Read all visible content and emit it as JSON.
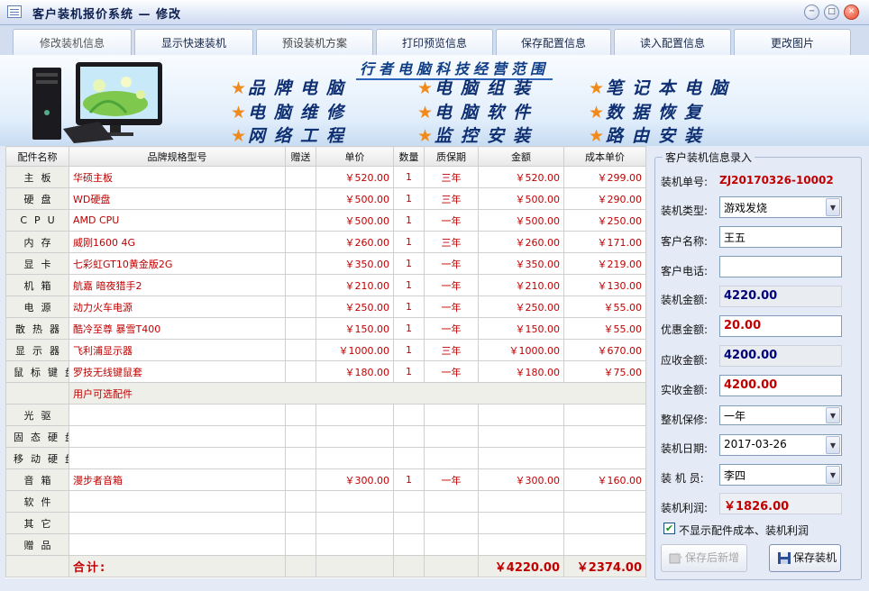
{
  "window": {
    "title": "客户装机报价系统 — 修改"
  },
  "tabs": [
    {
      "label": "修改装机信息"
    },
    {
      "label": "显示快速装机"
    },
    {
      "label": "预设装机方案"
    },
    {
      "label": "打印预览信息"
    },
    {
      "label": "保存配置信息"
    },
    {
      "label": "读入配置信息"
    },
    {
      "label": "更改图片"
    }
  ],
  "banner": {
    "title": "行者电脑科技经营范围",
    "items": [
      {
        "label": "品牌电脑"
      },
      {
        "label": "电脑组装"
      },
      {
        "label": "笔记本电脑"
      },
      {
        "label": "电脑维修"
      },
      {
        "label": "电脑软件"
      },
      {
        "label": "数据恢复"
      },
      {
        "label": "网络工程"
      },
      {
        "label": "监控安装"
      },
      {
        "label": "路由安装"
      }
    ]
  },
  "table": {
    "headers": [
      "配件名称",
      "品牌规格型号",
      "赠送",
      "单价",
      "数量",
      "质保期",
      "金额",
      "成本单价"
    ],
    "rows": [
      {
        "name": "主板",
        "brand": "华硕主板",
        "gift": "",
        "price": "￥520.00",
        "qty": "1",
        "warranty": "三年",
        "amount": "￥520.00",
        "cost": "￥299.00"
      },
      {
        "name": "硬盘",
        "brand": "WD硬盘",
        "gift": "",
        "price": "￥500.00",
        "qty": "1",
        "warranty": "三年",
        "amount": "￥500.00",
        "cost": "￥290.00"
      },
      {
        "name": "CPU",
        "brand": "AMD CPU",
        "gift": "",
        "price": "￥500.00",
        "qty": "1",
        "warranty": "一年",
        "amount": "￥500.00",
        "cost": "￥250.00"
      },
      {
        "name": "内存",
        "brand": "威刚1600 4G",
        "gift": "",
        "price": "￥260.00",
        "qty": "1",
        "warranty": "三年",
        "amount": "￥260.00",
        "cost": "￥171.00"
      },
      {
        "name": "显卡",
        "brand": "七彩虹GT10黄金版2G",
        "gift": "",
        "price": "￥350.00",
        "qty": "1",
        "warranty": "一年",
        "amount": "￥350.00",
        "cost": "￥219.00"
      },
      {
        "name": "机箱",
        "brand": "航嘉 暗夜猎手2",
        "gift": "",
        "price": "￥210.00",
        "qty": "1",
        "warranty": "一年",
        "amount": "￥210.00",
        "cost": "￥130.00"
      },
      {
        "name": "电源",
        "brand": "动力火车电源",
        "gift": "",
        "price": "￥250.00",
        "qty": "1",
        "warranty": "一年",
        "amount": "￥250.00",
        "cost": "￥55.00"
      },
      {
        "name": "散热器",
        "brand": "酷冷至尊 暴雪T400",
        "gift": "",
        "price": "￥150.00",
        "qty": "1",
        "warranty": "一年",
        "amount": "￥150.00",
        "cost": "￥55.00"
      },
      {
        "name": "显示器",
        "brand": "飞利浦显示器",
        "gift": "",
        "price": "￥1000.00",
        "qty": "1",
        "warranty": "三年",
        "amount": "￥1000.00",
        "cost": "￥670.00"
      },
      {
        "name": "鼠标键盘",
        "brand": "罗技无线键鼠套",
        "gift": "",
        "price": "￥180.00",
        "qty": "1",
        "warranty": "一年",
        "amount": "￥180.00",
        "cost": "￥75.00"
      }
    ],
    "optional_label": "用户可选配件",
    "optional_rows": [
      {
        "name": "光驱",
        "brand": "",
        "gift": "",
        "price": "",
        "qty": "",
        "warranty": "",
        "amount": "",
        "cost": ""
      },
      {
        "name": "固态硬盘",
        "brand": "",
        "gift": "",
        "price": "",
        "qty": "",
        "warranty": "",
        "amount": "",
        "cost": ""
      },
      {
        "name": "移动硬盘",
        "brand": "",
        "gift": "",
        "price": "",
        "qty": "",
        "warranty": "",
        "amount": "",
        "cost": ""
      },
      {
        "name": "音箱",
        "brand": "漫步者音箱",
        "gift": "",
        "price": "￥300.00",
        "qty": "1",
        "warranty": "一年",
        "amount": "￥300.00",
        "cost": "￥160.00"
      },
      {
        "name": "软件",
        "brand": "",
        "gift": "",
        "price": "",
        "qty": "",
        "warranty": "",
        "amount": "",
        "cost": ""
      },
      {
        "name": "其它",
        "brand": "",
        "gift": "",
        "price": "",
        "qty": "",
        "warranty": "",
        "amount": "",
        "cost": ""
      },
      {
        "name": "赠品",
        "brand": "",
        "gift": "",
        "price": "",
        "qty": "",
        "warranty": "",
        "amount": "",
        "cost": ""
      }
    ],
    "total": {
      "label": "合计:",
      "amount": "￥4220.00",
      "cost": "￥2374.00"
    }
  },
  "panel": {
    "title": "客户装机信息录入",
    "order_no_label": "装机单号:",
    "order_no": "ZJ20170326-10002",
    "type_label": "装机类型:",
    "type": "游戏发烧",
    "customer_label": "客户名称:",
    "customer": "王五",
    "phone_label": "客户电话:",
    "phone": "",
    "amount_label": "装机金额:",
    "amount": "4220.00",
    "discount_label": "优惠金额:",
    "discount": "20.00",
    "receivable_label": "应收金额:",
    "receivable": "4200.00",
    "received_label": "实收金额:",
    "received": "4200.00",
    "warranty_label": "整机保修:",
    "warranty": "一年",
    "date_label": "装机日期:",
    "date": "2017-03-26",
    "staff_label": "装 机 员:",
    "staff": "李四",
    "profit_label": "装机利润:",
    "profit": "￥1826.00",
    "hide_cost_label": "不显示配件成本、装机利润",
    "save_new_label": "保存后新增",
    "save_label": "保存装机"
  },
  "colors": {
    "accent_red": "#c00000",
    "banner_blue": "#0e2f72",
    "star": "#f08a1c"
  }
}
